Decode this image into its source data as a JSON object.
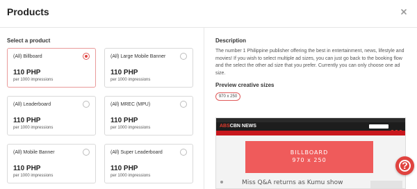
{
  "header": {
    "title": "Products"
  },
  "left": {
    "section_label": "Select a product",
    "products": [
      {
        "name": "(All) Billboard",
        "price": "110 PHP",
        "sub": "per 1000 impressions",
        "selected": true
      },
      {
        "name": "(All) Large Mobile Banner",
        "price": "110 PHP",
        "sub": "per 1000 impressions",
        "selected": false
      },
      {
        "name": "(All) Leaderboard",
        "price": "110 PHP",
        "sub": "per 1000 impressions",
        "selected": false
      },
      {
        "name": "(All) MREC (MPU)",
        "price": "110 PHP",
        "sub": "per 1000 impressions",
        "selected": false
      },
      {
        "name": "(All) Mobile Banner",
        "price": "110 PHP",
        "sub": "per 1000 impressions",
        "selected": false
      },
      {
        "name": "(All) Super Leaderboard",
        "price": "110 PHP",
        "sub": "per 1000 impressions",
        "selected": false
      }
    ]
  },
  "right": {
    "description_label": "Description",
    "description_text": "The number 1 Philippine publisher offering the best in entertainment, news, lifestyle and movies! If you wish to select multiple ad sizes, you can just go back to the booking flow and the select the other ad size that you prefer. Currently you can only choose one ad size.",
    "preview_label": "Preview creative sizes",
    "size_chip": "970 x 250",
    "preview": {
      "logo_brand": "ABS",
      "logo_rest": "CBN",
      "logo_suffix": " NEWS",
      "billboard_title": "BILLBOARD",
      "billboard_size": "970 x 250",
      "headline": "Miss Q&A returns as Kumu show"
    }
  },
  "colors": {
    "accent": "#e0433f",
    "billboard": "#ef5b5b",
    "nav": "#c8171d"
  },
  "icons": {
    "close": "close-icon",
    "help": "help-icon",
    "radio": "radio-icon"
  }
}
